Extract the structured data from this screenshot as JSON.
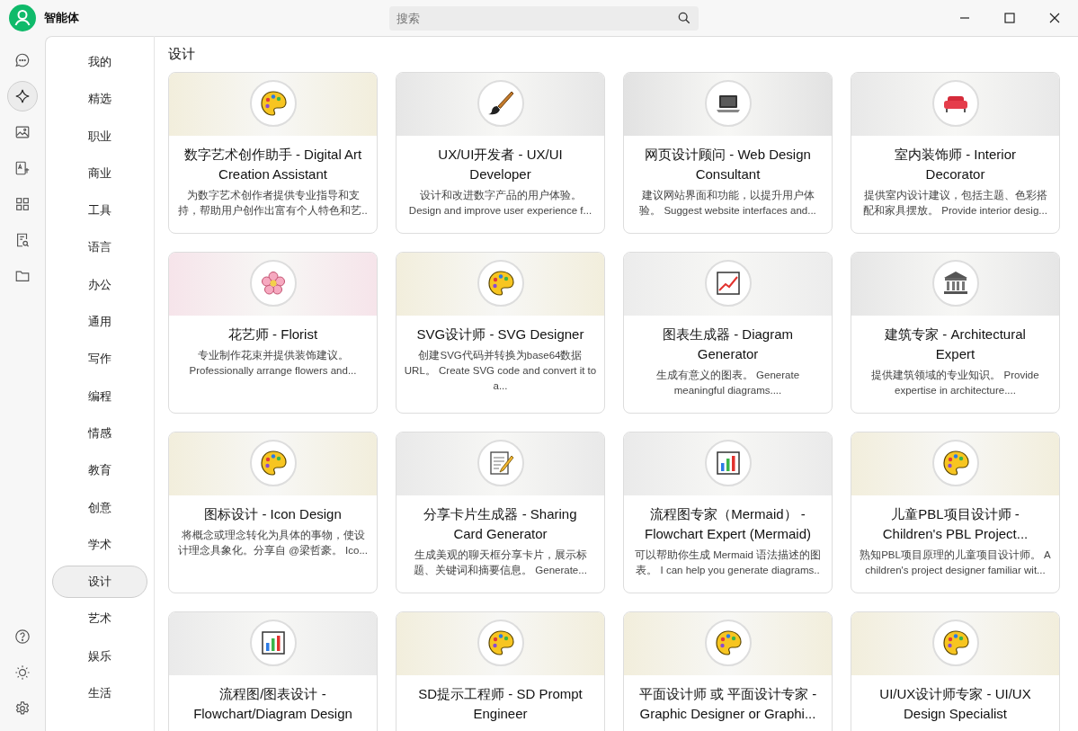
{
  "window": {
    "title": "智能体"
  },
  "search": {
    "placeholder": "搜索"
  },
  "nav_rail": [
    {
      "kind": "chat",
      "selected": false
    },
    {
      "kind": "sparkle",
      "selected": true
    },
    {
      "kind": "image",
      "selected": false
    },
    {
      "kind": "translate",
      "selected": false
    },
    {
      "kind": "apps",
      "selected": false
    },
    {
      "kind": "doc-search",
      "selected": false
    },
    {
      "kind": "folder",
      "selected": false
    }
  ],
  "nav_rail_bottom": [
    {
      "kind": "help"
    },
    {
      "kind": "theme"
    },
    {
      "kind": "settings"
    }
  ],
  "categories": [
    {
      "label": "我的",
      "selected": false
    },
    {
      "label": "精选",
      "selected": false
    },
    {
      "label": "职业",
      "selected": false
    },
    {
      "label": "商业",
      "selected": false
    },
    {
      "label": "工具",
      "selected": false
    },
    {
      "label": "语言",
      "selected": false
    },
    {
      "label": "办公",
      "selected": false
    },
    {
      "label": "通用",
      "selected": false
    },
    {
      "label": "写作",
      "selected": false
    },
    {
      "label": "编程",
      "selected": false
    },
    {
      "label": "情感",
      "selected": false
    },
    {
      "label": "教育",
      "selected": false
    },
    {
      "label": "创意",
      "selected": false
    },
    {
      "label": "学术",
      "selected": false
    },
    {
      "label": "设计",
      "selected": true
    },
    {
      "label": "艺术",
      "selected": false
    },
    {
      "label": "娱乐",
      "selected": false
    },
    {
      "label": "生活",
      "selected": false
    }
  ],
  "section_title": "设计",
  "agents": [
    {
      "kind": "palette",
      "title": "数字艺术创作助手 - Digital Art Creation Assistant",
      "description": "为数字艺术创作者提供专业指导和支持，帮助用户创作出富有个人特色和艺.."
    },
    {
      "kind": "brush",
      "title": "UX/UI开发者 - UX/UI Developer",
      "description": "设计和改进数字产品的用户体验。 Design and improve user experience f..."
    },
    {
      "kind": "laptop",
      "title": "网页设计顾问 - Web Design Consultant",
      "description": "建议网站界面和功能，以提升用户体验。 Suggest website interfaces and..."
    },
    {
      "kind": "sofa",
      "title": "室内装饰师 - Interior Decorator",
      "description": "提供室内设计建议，包括主题、色彩搭配和家具摆放。 Provide interior desig..."
    },
    {
      "kind": "flower",
      "title": "花艺师 - Florist",
      "description": "专业制作花束并提供装饰建议。 Professionally arrange flowers and..."
    },
    {
      "kind": "palette",
      "title": "SVG设计师 - SVG Designer",
      "description": "创建SVG代码并转换为base64数据URL。 Create SVG code and convert it to a..."
    },
    {
      "kind": "line-chart",
      "title": "图表生成器 - Diagram Generator",
      "description": "生成有意义的图表。 Generate meaningful diagrams...."
    },
    {
      "kind": "building",
      "title": "建筑专家 - Architectural Expert",
      "description": "提供建筑领域的专业知识。 Provide expertise in architecture...."
    },
    {
      "kind": "palette",
      "title": "图标设计 - Icon Design",
      "description": "将概念或理念转化为具体的事物，使设计理念具象化。分享自 @梁哲豪。 Ico..."
    },
    {
      "kind": "memo",
      "title": "分享卡片生成器 - Sharing Card Generator",
      "description": "生成美观的聊天框分享卡片，展示标题、关键词和摘要信息。 Generate..."
    },
    {
      "kind": "bar-chart",
      "title": "流程图专家（Mermaid） - Flowchart Expert (Mermaid)",
      "description": "可以帮助你生成 Mermaid 语法描述的图表。 I can help you generate diagrams.."
    },
    {
      "kind": "palette",
      "title": "儿童PBL项目设计师 - Children's PBL Project...",
      "description": "熟知PBL项目原理的儿童项目设计师。 A children's project designer familiar wit..."
    },
    {
      "kind": "bar-chart",
      "title": "流程图/图表设计 - Flowchart/Diagram Design"
    },
    {
      "kind": "palette",
      "title": "SD提示工程师 - SD Prompt Engineer"
    },
    {
      "kind": "palette",
      "title": "平面设计师 或 平面设计专家 - Graphic Designer or Graphi..."
    },
    {
      "kind": "palette",
      "title": "UI/UX设计师专家 - UI/UX Design Specialist"
    }
  ]
}
